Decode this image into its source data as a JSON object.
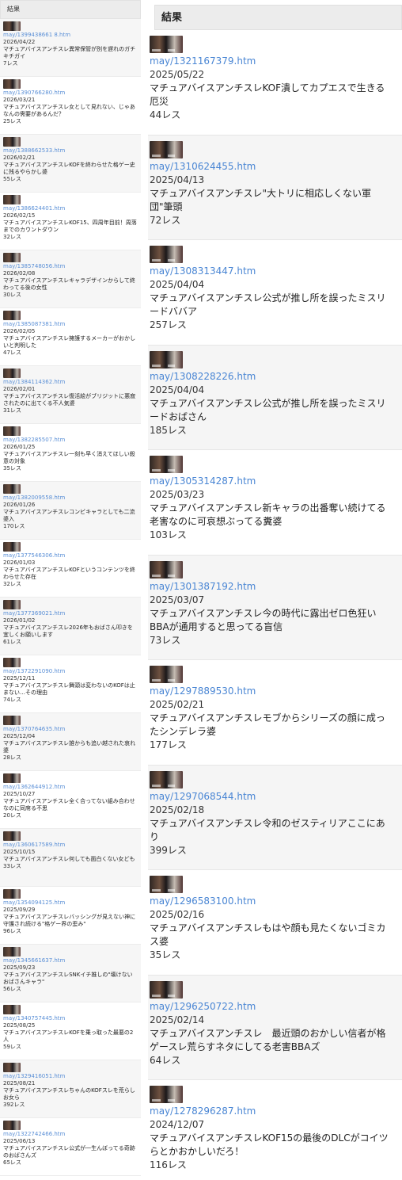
{
  "left": {
    "header": "結果",
    "items": [
      {
        "url": "may/1399438661 8.htm",
        "date": "2026/04/22",
        "title": "マチュアバイスアンチスレ異常保管が別を遅れのガチキチガイ",
        "count": "7レス"
      },
      {
        "url": "may/1390766280.htm",
        "date": "2026/03/21",
        "title": "マチュアバイスアンチスレ女として見れない、じゃあなんの需要があるんだ？",
        "count": "25レス"
      },
      {
        "url": "may/1388662533.htm",
        "date": "2026/02/21",
        "title": "マチュアバイスアンチスレKOFを終わらせた格ゲー史に残るやらかし婆",
        "count": "55レス"
      },
      {
        "url": "may/1386624401.htm",
        "date": "2026/02/15",
        "title": "マチュアバイスアンチスレKOF15、四周年目前！周落までのカウントダウン",
        "count": "32レス"
      },
      {
        "url": "may/1385748056.htm",
        "date": "2026/02/08",
        "title": "マチュアバイスアンチスレキャラデザインからして終わってる後の女性",
        "count": "30レス"
      },
      {
        "url": "may/1385087381.htm",
        "date": "2026/02/05",
        "title": "マチュアバイスアンチスレ擁護するメーカーがおかしいと判明した",
        "count": "47レス"
      },
      {
        "url": "may/1384114362.htm",
        "date": "2026/02/01",
        "title": "マチュアバイスアンチスレ復活絵がブリジットに悪寂されたのに出てくる不人気婆",
        "count": "31レス"
      },
      {
        "url": "may/1382285507.htm",
        "date": "2026/01/25",
        "title": "マチュアバイスアンチスレ一刻も早く消えてほしい殺意の対象",
        "count": "35レス"
      },
      {
        "url": "may/1382009558.htm",
        "date": "2026/01/26",
        "title": "マチュアバイスアンチスレコンビキャラとしても二流婆入",
        "count": "170レス"
      },
      {
        "url": "may/1377546306.htm",
        "date": "2026/01/03",
        "title": "マチュアバイスアンチスレKOFというコンテンツを終わらせた存在",
        "count": "32レス"
      },
      {
        "url": "may/1377369021.htm",
        "date": "2026/01/02",
        "title": "マチュアバイスアンチスレ2026年もおばさん叩きを宜しくお願いします",
        "count": "61レス"
      },
      {
        "url": "may/1372291090.htm",
        "date": "2025/12/11",
        "title": "マチュアバイスアンチスレ舞頭は変わないのKOFは止まない…その理由",
        "count": "74レス"
      },
      {
        "url": "may/1370764635.htm",
        "date": "2025/12/04",
        "title": "マチュアバイスアンチスレ誰からも追い越された哀れ婆",
        "count": "28レス"
      },
      {
        "url": "may/1362644912.htm",
        "date": "2025/10/27",
        "title": "マチュアバイスアンチスレ全く合ってない組み合わせなのに同席る不思",
        "count": "20レス"
      },
      {
        "url": "may/1360617589.htm",
        "date": "2025/10/15",
        "title": "マチュアバイスアンチスレ何しても面白くない女ども",
        "count": "33レス"
      },
      {
        "url": "may/1354094125.htm",
        "date": "2025/09/29",
        "title": "マチュアバイスアンチスレバッシングが見えない神に守護され続ける\"格ゲー界の歪み\"",
        "count": "96レス"
      },
      {
        "url": "may/1345661637.htm",
        "date": "2025/09/23",
        "title": "マチュアバイスアンチスレSNKイチ推しの\"壊けないおばさんキャラ\"",
        "count": "56レス"
      },
      {
        "url": "may/1340757445.htm",
        "date": "2025/08/25",
        "title": "マチュアバイスアンチスレKOFを乗っ取った最悪の2人",
        "count": "59レス"
      },
      {
        "url": "may/1329416051.htm",
        "date": "2025/08/21",
        "title": "マチュアバイスアンチスレちゃんのKOFスレを荒らしお女ら",
        "count": "392レス"
      },
      {
        "url": "may/1322742466.htm",
        "date": "2025/06/13",
        "title": "マチュアバイスアンチスレ公式が一生んぼってる奇跡のおばさんズ",
        "count": "65レス"
      }
    ]
  },
  "right": {
    "header": "結果",
    "items": [
      {
        "url": "may/1321167379.htm",
        "date": "2025/05/22",
        "title": "マチュアバイスアンチスレKOF潰してカプエスで生きる厄災",
        "count": "44レス"
      },
      {
        "url": "may/1310624455.htm",
        "date": "2025/04/13",
        "title": "マチュアバイスアンチスレ\"大トリに相応しくない軍団\"筆頭",
        "count": "72レス"
      },
      {
        "url": "may/1308313447.htm",
        "date": "2025/04/04",
        "title": "マチュアバイスアンチスレ公式が推し所を誤ったミスリードババア",
        "count": "257レス"
      },
      {
        "url": "may/1308228226.htm",
        "date": "2025/04/04",
        "title": "マチュアバイスアンチスレ公式が推し所を誤ったミスリードおばさん",
        "count": "185レス"
      },
      {
        "url": "may/1305314287.htm",
        "date": "2025/03/23",
        "title": "マチュアバイスアンチスレ新キャラの出番奪い続けてる老害なのに可哀想ぶってる糞婆",
        "count": "103レス"
      },
      {
        "url": "may/1301387192.htm",
        "date": "2025/03/07",
        "title": "マチュアバイスアンチスレ今の時代に露出ゼロ色狂いBBAが通用すると思ってる盲信",
        "count": "73レス"
      },
      {
        "url": "may/1297889530.htm",
        "date": "2025/02/21",
        "title": "マチュアバイスアンチスレモブからシリーズの顔に成ったシンデレラ婆",
        "count": "177レス"
      },
      {
        "url": "may/1297068544.htm",
        "date": "2025/02/18",
        "title": "マチュアバイスアンチスレ令和のゼスティリアここにあり",
        "count": "399レス"
      },
      {
        "url": "may/1296583100.htm",
        "date": "2025/02/16",
        "title": "マチュアバイスアンチスレもはや顔も見たくないゴミカス婆",
        "count": "35レス"
      },
      {
        "url": "may/1296250722.htm",
        "date": "2025/02/14",
        "title": "マチュアバイスアンチスレ　最近頭のおかしい信者が格ゲースレ荒らすネタにしてる老害BBAズ",
        "count": "64レス"
      },
      {
        "url": "may/1278296287.htm",
        "date": "2024/12/07",
        "title": "マチュアバイスアンチスレKOF15の最後のDLCがコイツらとかおかしいだろ！",
        "count": "116レス"
      }
    ]
  }
}
